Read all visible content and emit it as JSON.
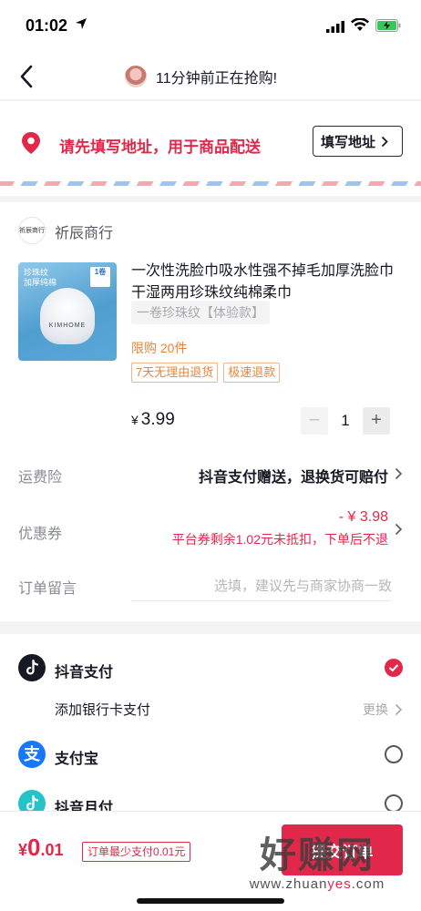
{
  "status_bar": {
    "time": "01:02"
  },
  "nav": {
    "title": "11分钟前正在抢购!"
  },
  "address": {
    "prompt": "请先填写地址，用于商品配送",
    "button_label": "填写地址"
  },
  "shop": {
    "logo_text": "祈辰商行",
    "name": "祈辰商行"
  },
  "product": {
    "image_tag": "珍珠纹\n加厚纯棉",
    "image_badge": "1卷",
    "image_brand": "KIMHOME",
    "title": "一次性洗脸巾吸水性强不掉毛加厚洗脸巾干湿两用珍珠纹纯棉柔巾",
    "sku": "一卷珍珠纹【体验款】",
    "limit": "限购 20件",
    "tags": [
      "7天无理由退货",
      "极速退款"
    ],
    "price_symbol": "¥",
    "price": "3.99",
    "qty_minus": "−",
    "qty": "1",
    "qty_plus": "+"
  },
  "freight": {
    "label": "运费险",
    "value": "抖音支付赠送，退换货可赔付"
  },
  "coupon": {
    "label": "优惠券",
    "amount": "- ¥ 3.98",
    "note": "平台券剩余1.02元未抵扣，下单后不退"
  },
  "order_note": {
    "label": "订单留言",
    "placeholder": "选填，建议先与商家协商一致"
  },
  "payment": {
    "douyin_pay": "抖音支付",
    "bank_card": "添加银行卡支付",
    "change": "更换",
    "alipay": "支付宝",
    "alipay_icon_char": "支",
    "monthly": "抖音月付",
    "selected": "douyin_pay",
    "accent_color": "#e1284a"
  },
  "bottom": {
    "total_symbol": "¥",
    "total_int": "0",
    "total_dec": ".01",
    "min_note": "订单最少支付0.01元",
    "submit_label": "提交订单"
  },
  "watermark": {
    "main": "好赚网",
    "url_pre": "www.zhuan",
    "url_hl": "yes",
    "url_post": ".com"
  }
}
